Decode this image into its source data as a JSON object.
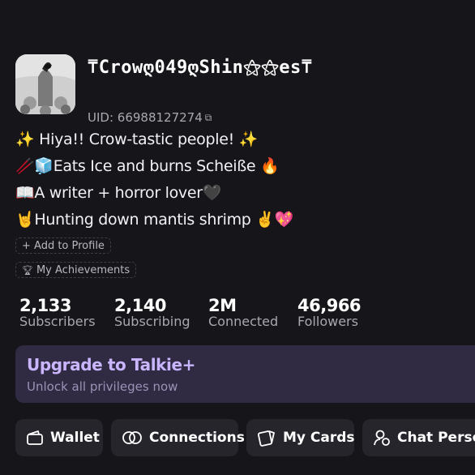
{
  "profile": {
    "username": "⍑Crowღ049ღShin⚝⚝es⍑",
    "uid_label": "UID: 66988127274",
    "bio": [
      "✨ Hiya!! Crow-tastic people! ✨",
      "🥢🧊Eats Ice and burns Scheiße 🔥",
      "📖A writer + horror lover🖤",
      "🤘Hunting down mantis shrimp ✌️💖"
    ],
    "add_to_profile": "+ Add to Profile",
    "achievements": "My Achievements"
  },
  "stats": [
    {
      "value": "2,133",
      "label": "Subscribers"
    },
    {
      "value": "2,140",
      "label": "Subscribing"
    },
    {
      "value": "2M",
      "label": "Connected"
    },
    {
      "value": "46,966",
      "label": "Followers"
    }
  ],
  "upgrade": {
    "title": "Upgrade to Talkie+",
    "subtitle": "Unlock all privileges now"
  },
  "quick_actions": [
    {
      "label": "Wallet",
      "icon": "wallet-icon"
    },
    {
      "label": "Connections",
      "icon": "connections-icon"
    },
    {
      "label": "My Cards",
      "icon": "cards-icon"
    },
    {
      "label": "Chat Person",
      "icon": "chat-persona-icon"
    }
  ],
  "colors": {
    "background": "#16151a",
    "upgrade_bg": "#302a43",
    "upgrade_title": "#c9b6ff",
    "button_bg": "#26252c"
  }
}
